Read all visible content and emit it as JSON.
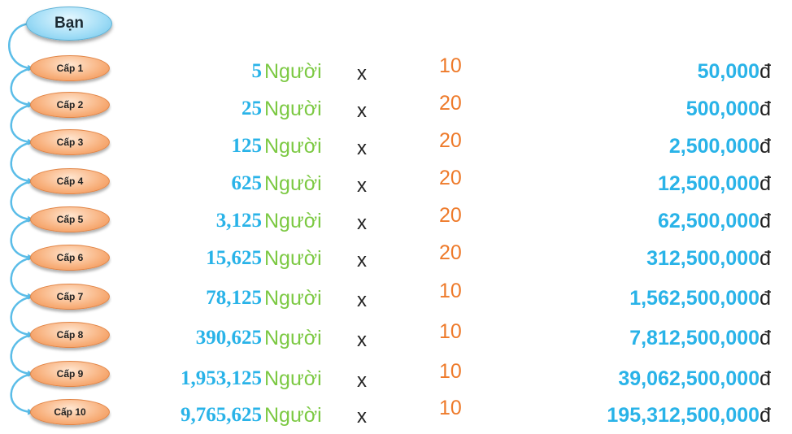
{
  "root": {
    "label": "Bạn"
  },
  "rows": [
    {
      "level": "Cấp 1",
      "count": "5",
      "unit": "Người",
      "op": "x",
      "amount": "10",
      "total": "50,000",
      "currency": "đ"
    },
    {
      "level": "Cấp 2",
      "count": "25",
      "unit": "Người",
      "op": "x",
      "amount": "20",
      "total": "500,000",
      "currency": "đ"
    },
    {
      "level": "Cấp 3",
      "count": "125",
      "unit": "Người",
      "op": "x",
      "amount": "20",
      "total": "2,500,000",
      "currency": "đ"
    },
    {
      "level": "Cấp 4",
      "count": "625",
      "unit": "Người",
      "op": "x",
      "amount": "20",
      "total": "12,500,000",
      "currency": "đ"
    },
    {
      "level": "Cấp 5",
      "count": "3,125",
      "unit": "Người",
      "op": "x",
      "amount": "20",
      "total": "62,500,000",
      "currency": "đ"
    },
    {
      "level": "Cấp 6",
      "count": "15,625",
      "unit": "Người",
      "op": "x",
      "amount": "20",
      "total": "312,500,000",
      "currency": "đ"
    },
    {
      "level": "Cấp 7",
      "count": "78,125",
      "unit": "Người",
      "op": "x",
      "amount": "10",
      "total": "1,562,500,000",
      "currency": "đ"
    },
    {
      "level": "Cấp 8",
      "count": "390,625",
      "unit": "Người",
      "op": "x",
      "amount": "10",
      "total": "7,812,500,000",
      "currency": "đ"
    },
    {
      "level": "Cấp 9",
      "count": "1,953,125",
      "unit": "Người",
      "op": "x",
      "amount": "10",
      "total": "39,062,500,000",
      "currency": "đ"
    },
    {
      "level": "Cấp 10",
      "count": "9,765,625",
      "unit": "Người",
      "op": "x",
      "amount": "10",
      "total": "195,312,500,000",
      "currency": "đ"
    }
  ],
  "colors": {
    "root_fill": "#9fdcf6",
    "level_fill": "#f8b07c",
    "arrow": "#5bbde8",
    "count": "#29b3e8",
    "people": "#7cc943",
    "amount": "#ee7a2a",
    "total": "#29b3e8",
    "text_dark": "#222222"
  },
  "icons": {
    "connector": "curved-arrow-icon"
  }
}
